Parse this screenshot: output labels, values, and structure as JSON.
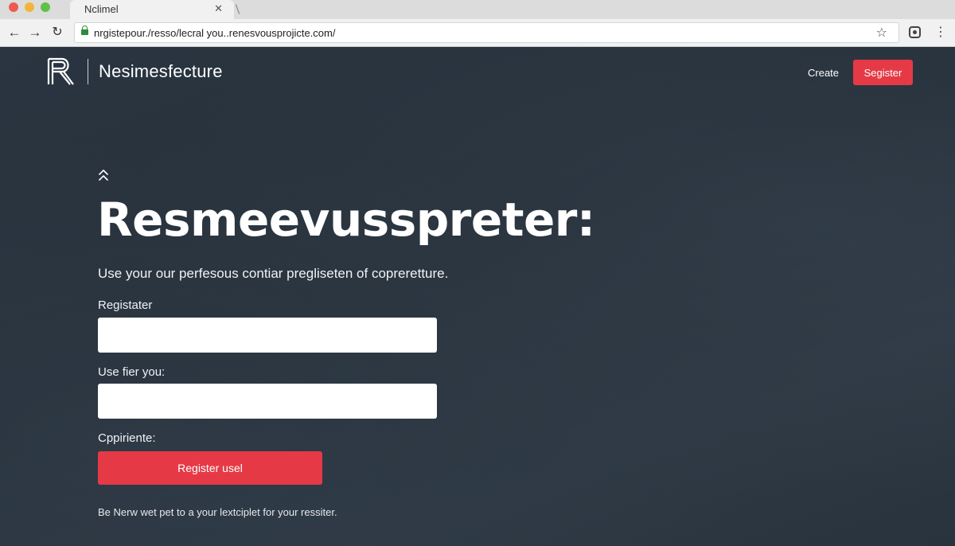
{
  "browser": {
    "tab_title": "Nclimel",
    "tab_close": "✕",
    "url": "nrgistepour./resso/lecral you..renesvousprojicte.com/",
    "icons": {
      "back": "←",
      "forward": "→",
      "reload": "↻",
      "bookmark": "☆",
      "menu": "⋮"
    }
  },
  "header": {
    "brand": "Nesimesfecture",
    "nav_link": "Create",
    "register_label": "Segister"
  },
  "hero": {
    "title": "Resmeevusspreter:",
    "subtitle": "Use your our perfesous contiar pregliseten of copreretture."
  },
  "form": {
    "field1_label": "Registater",
    "field1_value": "",
    "field2_label": "Use fier you:",
    "field2_value": "",
    "field3_label": "Cppiriente:",
    "submit_label": "Register usel"
  },
  "footer": {
    "note": "Be Nerw wet pet to a your lextciplet for your ressiter."
  },
  "colors": {
    "accent": "#e53a46",
    "page_bg": "#27313b"
  }
}
